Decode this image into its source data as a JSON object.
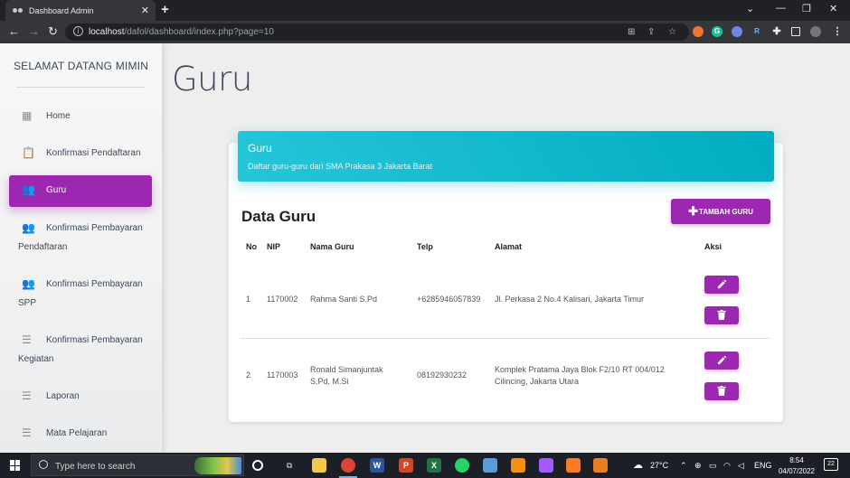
{
  "browser": {
    "tab_title": "Dashboard Admin",
    "tab_close": "✕",
    "new_tab": "+",
    "url_host": "localhost",
    "url_path": "/dafol/dashboard/index.php?page=10",
    "window_controls": [
      "⌄",
      "—",
      "❐",
      "✕"
    ],
    "extensions": [
      "G",
      "R"
    ]
  },
  "sidebar": {
    "brand": "SELAMAT DATANG MIMIN",
    "items": [
      {
        "label": "Home",
        "icon": "dashboard-icon"
      },
      {
        "label": "Konfirmasi Pendaftaran",
        "icon": "clipboard-icon"
      },
      {
        "label": "Guru",
        "icon": "people-icon",
        "active": true
      },
      {
        "label": "Konfirmasi Pembayaran",
        "label2": "Pendaftaran",
        "icon": "people-icon"
      },
      {
        "label": "Konfirmasi Pembayaran",
        "label2": "SPP",
        "icon": "people-icon"
      },
      {
        "label": "Konfirmasi Pembayaran",
        "label2": "Kegiatan",
        "icon": "list-icon"
      },
      {
        "label": "Laporan",
        "icon": "list-icon"
      },
      {
        "label": "Mata Pelajaran",
        "icon": "list-icon"
      }
    ]
  },
  "main": {
    "page_title": "Guru",
    "card_header": {
      "title": "Guru",
      "subtitle": "Daftar guru-guru dari SMA Prakasa 3 Jakarta Barat"
    },
    "section_title": "Data Guru",
    "add_button": "TAMBAH GURU",
    "table": {
      "headers": [
        "No",
        "NIP",
        "Nama Guru",
        "Telp",
        "Alamat",
        "Aksi"
      ],
      "rows": [
        {
          "no": "1",
          "nip": "1170002",
          "nama": "Rahma Santi S.Pd",
          "nama2": "",
          "telp": "+6285946057839",
          "alamat": "Jl. Perkasa 2 No.4 Kalisari, Jakarta Timur",
          "alamat2": ""
        },
        {
          "no": "2",
          "nip": "1170003",
          "nama": "Ronald Simanjuntak",
          "nama2": "S.Pd, M.Si",
          "telp": "08192930232",
          "alamat": "Komplek Pratama Jaya Blok F2/10 RT 004/012",
          "alamat2": "Cilincing, Jakarta Utara"
        }
      ]
    },
    "accent_color": "#9c27b0",
    "header_color": "#00bcd4"
  },
  "taskbar": {
    "search_placeholder": "Type here to search",
    "weather": "27°C",
    "language": "ENG",
    "time": "8:54",
    "date": "04/07/2022",
    "notifications": "22"
  }
}
